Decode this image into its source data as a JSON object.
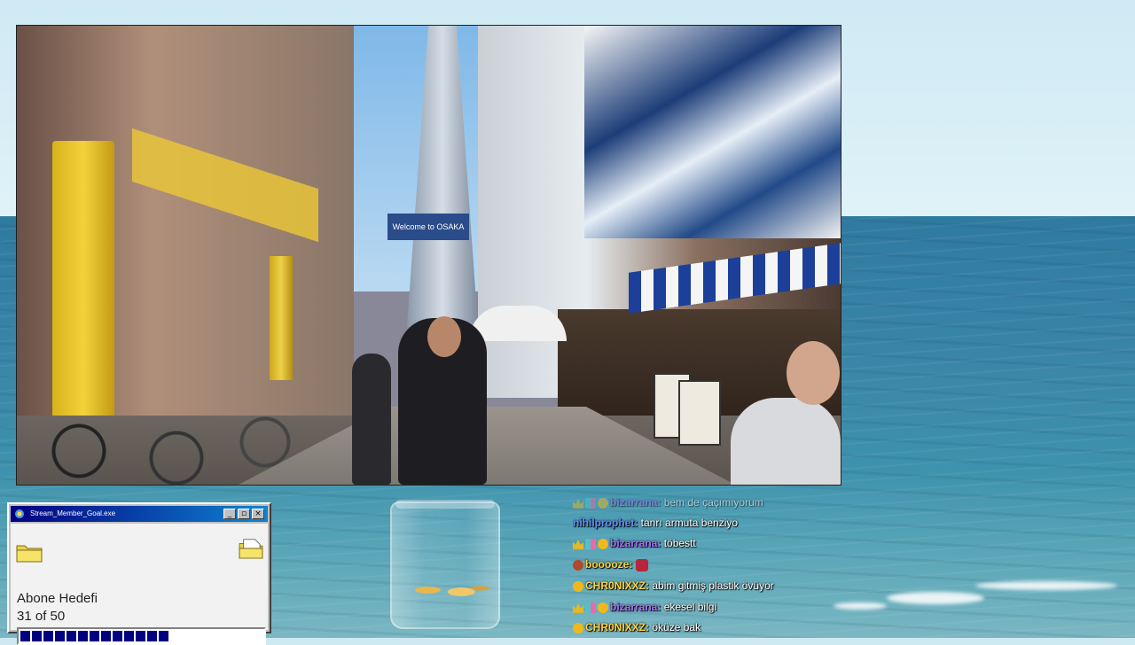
{
  "colors": {
    "title_bar": "#000080",
    "progress": "#000080",
    "user_nihilprophet": "#5f8cff",
    "user_bizarrana": "#a86bff",
    "user_booooze": "#ffd23c",
    "user_chr0nixxz": "#ffd23c"
  },
  "window": {
    "title": "Stream_Member_Goal.exe",
    "minimize_icon": "minimize-icon",
    "maximize_icon": "maximize-icon",
    "close_icon": "close-icon",
    "goal_label": "Abone Hedefi",
    "goal_count": "31 of 50",
    "progress_fraction": 0.62
  },
  "video": {
    "tower_sign": "Welcome to OSAKA"
  },
  "chat": {
    "messages": [
      {
        "user": "bizarrana",
        "text": "bem de çaçımıyorum",
        "faded": true
      },
      {
        "user": "nihilprophet",
        "text": "tanrı armuta benziyo"
      },
      {
        "user": "bizarrana",
        "text": "töbestt"
      },
      {
        "user": "booooze",
        "text": ""
      },
      {
        "user": "CHR0NIXXZ",
        "text": "abim gitmiş plastik övüyor"
      },
      {
        "user": "bizarrana",
        "text": "ekesel bilgi"
      },
      {
        "user": "CHR0NIXXZ",
        "text": "öküze bak"
      }
    ]
  }
}
